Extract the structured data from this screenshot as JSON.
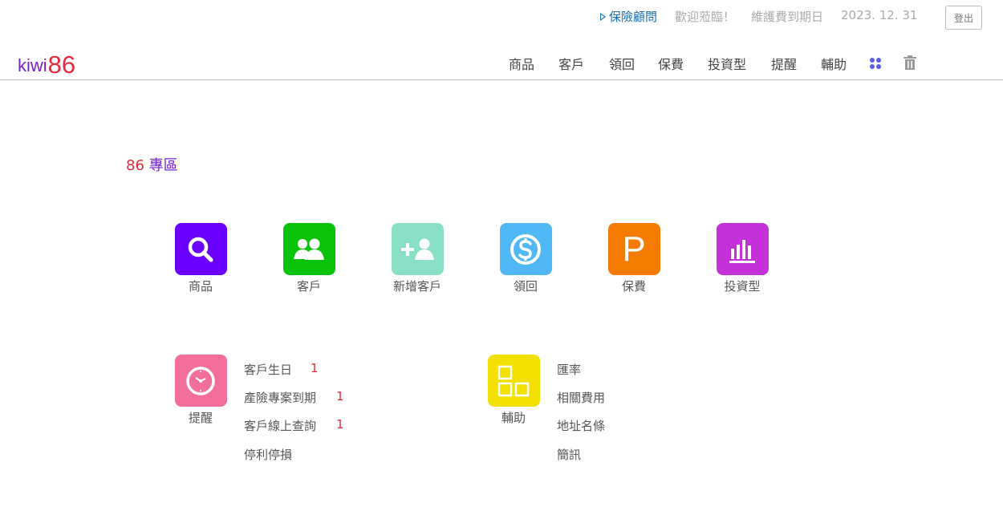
{
  "header": {
    "advisor_label": "保險顧問",
    "welcome": "歡迎蒞臨！",
    "maintenance_label": "維護費到期日",
    "maintenance_date": "2023. 12. 31",
    "logout_label": "登出"
  },
  "logo": {
    "text": "kiwi",
    "number": "86"
  },
  "nav": {
    "items": [
      {
        "label": "商品"
      },
      {
        "label": "客戶"
      },
      {
        "label": "領回"
      },
      {
        "label": "保費"
      },
      {
        "label": "投資型"
      },
      {
        "label": "提醒"
      },
      {
        "label": "輔助"
      }
    ],
    "grid_icon": "apps-grid-icon",
    "trash_icon": "trash-icon"
  },
  "zone": {
    "number": "86",
    "title": "專區"
  },
  "tiles": [
    {
      "label": "商品",
      "icon": "search-icon",
      "color": "#6a00ff"
    },
    {
      "label": "客戶",
      "icon": "users-icon",
      "color": "#0ac20a"
    },
    {
      "label": "新增客戶",
      "icon": "add-user-icon",
      "color": "#8ae0c7"
    },
    {
      "label": "領回",
      "icon": "dollar-icon",
      "color": "#4fb8f5"
    },
    {
      "label": "保費",
      "icon": "p-letter-icon",
      "glyph": "P",
      "color": "#f47a00"
    },
    {
      "label": "投資型",
      "icon": "bar-chart-icon",
      "color": "#c531d8"
    }
  ],
  "reminder": {
    "label": "提醒",
    "icon": "clock-icon",
    "color": "#f36f9a",
    "items": [
      {
        "label": "客戶生日",
        "count": "1"
      },
      {
        "label": "產險專案到期",
        "count": "1"
      },
      {
        "label": "客戶線上查詢",
        "count": "1"
      },
      {
        "label": "停利停損"
      }
    ]
  },
  "assist": {
    "label": "輔助",
    "icon": "squares-icon",
    "color": "#f2e100",
    "items": [
      {
        "label": "匯率"
      },
      {
        "label": "相關費用"
      },
      {
        "label": "地址名條"
      },
      {
        "label": "簡訊"
      }
    ]
  }
}
